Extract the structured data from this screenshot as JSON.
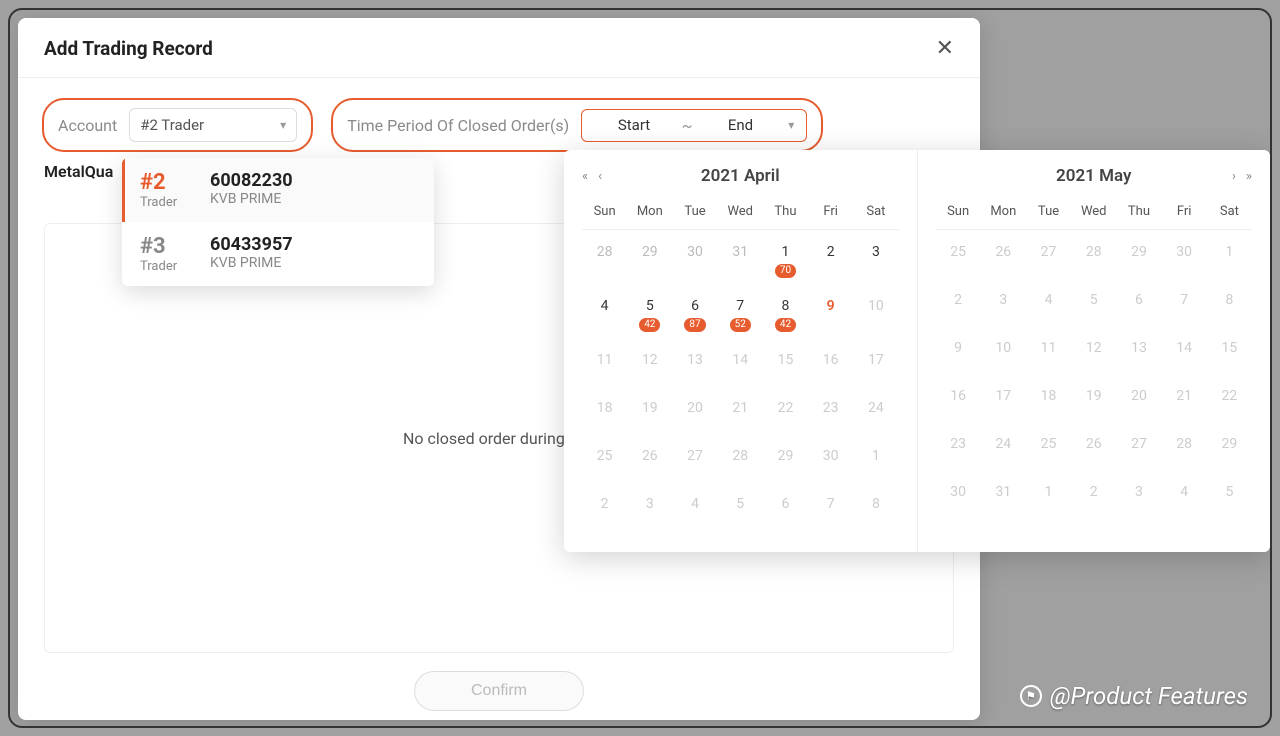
{
  "modal": {
    "title": "Add Trading Record",
    "account_label": "Account",
    "account_value": "#2 Trader",
    "period_label": "Time Period Of Closed Order(s)",
    "date_start": "Start",
    "date_end": "End",
    "metal_label": "MetalQua",
    "empty_text": "No closed order during this",
    "confirm_label": "Confirm"
  },
  "dropdown": {
    "trader_label": "Trader",
    "items": [
      {
        "rank": "#2",
        "account": "60082230",
        "broker": "KVB PRIME",
        "active": true
      },
      {
        "rank": "#3",
        "account": "60433957",
        "broker": "KVB PRIME",
        "active": false
      }
    ]
  },
  "calendar": {
    "weekdays": [
      "Sun",
      "Mon",
      "Tue",
      "Wed",
      "Thu",
      "Fri",
      "Sat"
    ],
    "left": {
      "title": "2021 April",
      "days": [
        {
          "n": "28",
          "in": false
        },
        {
          "n": "29",
          "in": false
        },
        {
          "n": "30",
          "in": false
        },
        {
          "n": "31",
          "in": false
        },
        {
          "n": "1",
          "in": true,
          "badge": "70"
        },
        {
          "n": "2",
          "in": true
        },
        {
          "n": "3",
          "in": true
        },
        {
          "n": "4",
          "in": true
        },
        {
          "n": "5",
          "in": true,
          "badge": "42"
        },
        {
          "n": "6",
          "in": true,
          "badge": "87"
        },
        {
          "n": "7",
          "in": true,
          "badge": "52"
        },
        {
          "n": "8",
          "in": true,
          "badge": "42"
        },
        {
          "n": "9",
          "in": true,
          "today": true
        },
        {
          "n": "10",
          "in": false,
          "muted": true
        },
        {
          "n": "11",
          "in": false,
          "muted": true
        },
        {
          "n": "12",
          "in": false,
          "muted": true
        },
        {
          "n": "13",
          "in": false,
          "muted": true
        },
        {
          "n": "14",
          "in": false,
          "muted": true
        },
        {
          "n": "15",
          "in": false,
          "muted": true
        },
        {
          "n": "16",
          "in": false,
          "muted": true
        },
        {
          "n": "17",
          "in": false,
          "muted": true
        },
        {
          "n": "18",
          "in": false,
          "muted": true
        },
        {
          "n": "19",
          "in": false,
          "muted": true
        },
        {
          "n": "20",
          "in": false,
          "muted": true
        },
        {
          "n": "21",
          "in": false,
          "muted": true
        },
        {
          "n": "22",
          "in": false,
          "muted": true
        },
        {
          "n": "23",
          "in": false,
          "muted": true
        },
        {
          "n": "24",
          "in": false,
          "muted": true
        },
        {
          "n": "25",
          "in": false,
          "muted": true
        },
        {
          "n": "26",
          "in": false,
          "muted": true
        },
        {
          "n": "27",
          "in": false,
          "muted": true
        },
        {
          "n": "28",
          "in": false,
          "muted": true
        },
        {
          "n": "29",
          "in": false,
          "muted": true
        },
        {
          "n": "30",
          "in": false,
          "muted": true
        },
        {
          "n": "1",
          "in": false,
          "muted": true
        },
        {
          "n": "2",
          "in": false,
          "muted": true
        },
        {
          "n": "3",
          "in": false,
          "muted": true
        },
        {
          "n": "4",
          "in": false,
          "muted": true
        },
        {
          "n": "5",
          "in": false,
          "muted": true
        },
        {
          "n": "6",
          "in": false,
          "muted": true
        },
        {
          "n": "7",
          "in": false,
          "muted": true
        },
        {
          "n": "8",
          "in": false,
          "muted": true
        }
      ]
    },
    "right": {
      "title": "2021 May",
      "days": [
        {
          "n": "25",
          "muted": true
        },
        {
          "n": "26",
          "muted": true
        },
        {
          "n": "27",
          "muted": true
        },
        {
          "n": "28",
          "muted": true
        },
        {
          "n": "29",
          "muted": true
        },
        {
          "n": "30",
          "muted": true
        },
        {
          "n": "1",
          "muted": true
        },
        {
          "n": "2",
          "muted": true
        },
        {
          "n": "3",
          "muted": true
        },
        {
          "n": "4",
          "muted": true
        },
        {
          "n": "5",
          "muted": true
        },
        {
          "n": "6",
          "muted": true
        },
        {
          "n": "7",
          "muted": true
        },
        {
          "n": "8",
          "muted": true
        },
        {
          "n": "9",
          "muted": true
        },
        {
          "n": "10",
          "muted": true
        },
        {
          "n": "11",
          "muted": true
        },
        {
          "n": "12",
          "muted": true
        },
        {
          "n": "13",
          "muted": true
        },
        {
          "n": "14",
          "muted": true
        },
        {
          "n": "15",
          "muted": true
        },
        {
          "n": "16",
          "muted": true
        },
        {
          "n": "17",
          "muted": true
        },
        {
          "n": "18",
          "muted": true
        },
        {
          "n": "19",
          "muted": true
        },
        {
          "n": "20",
          "muted": true
        },
        {
          "n": "21",
          "muted": true
        },
        {
          "n": "22",
          "muted": true
        },
        {
          "n": "23",
          "muted": true
        },
        {
          "n": "24",
          "muted": true
        },
        {
          "n": "25",
          "muted": true
        },
        {
          "n": "26",
          "muted": true
        },
        {
          "n": "27",
          "muted": true
        },
        {
          "n": "28",
          "muted": true
        },
        {
          "n": "29",
          "muted": true
        },
        {
          "n": "30",
          "muted": true
        },
        {
          "n": "31",
          "muted": true
        },
        {
          "n": "1",
          "muted": true
        },
        {
          "n": "2",
          "muted": true
        },
        {
          "n": "3",
          "muted": true
        },
        {
          "n": "4",
          "muted": true
        },
        {
          "n": "5",
          "muted": true
        }
      ]
    }
  },
  "watermark": "@Product Features"
}
